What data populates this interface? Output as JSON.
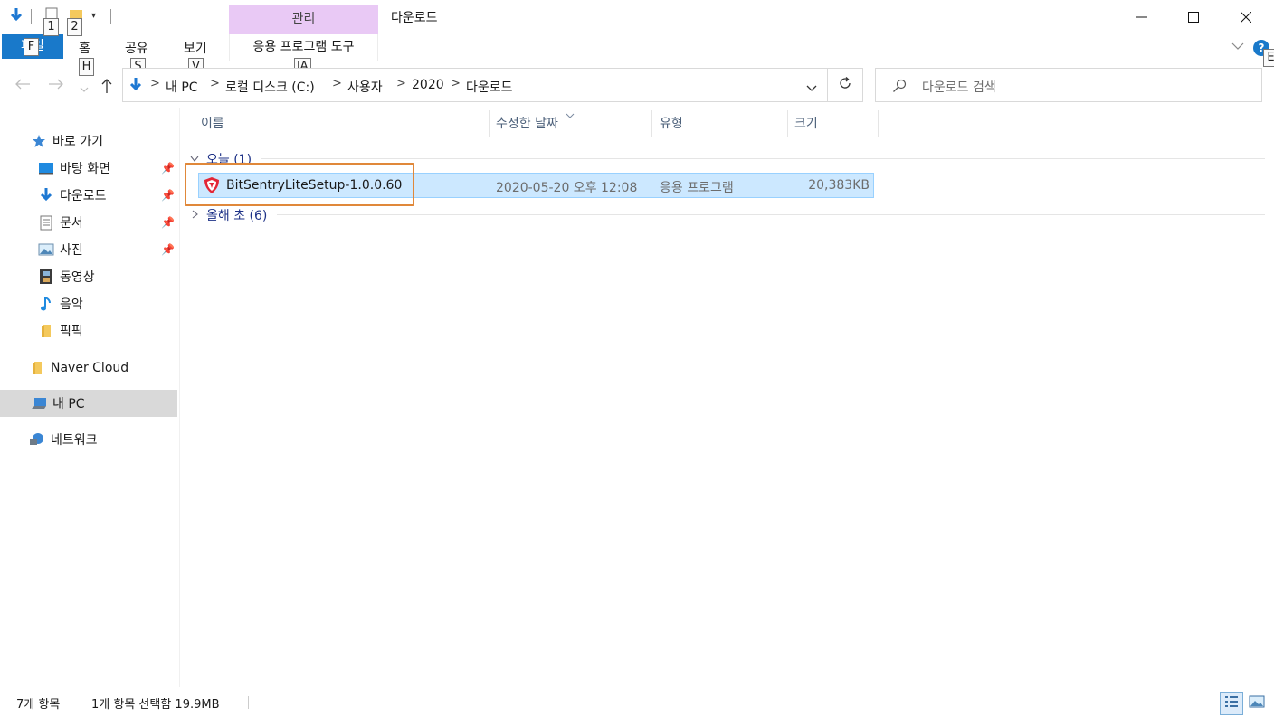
{
  "window": {
    "title": "다운로드",
    "contextual_tab": "관리",
    "contextual_group": "응용 프로그램 도구"
  },
  "ribbon": {
    "tabs": {
      "file": "파일",
      "home": "홈",
      "share": "공유",
      "view": "보기"
    },
    "keytips": {
      "qa1": "1",
      "qa2": "2",
      "file": "F",
      "home": "H",
      "share": "S",
      "view": "V",
      "apptools": "JA",
      "help": "E"
    }
  },
  "address": {
    "crumbs": [
      "내 PC",
      "로컬 디스크 (C:)",
      "사용자",
      "2020",
      "다운로드"
    ],
    "separator": ">"
  },
  "search": {
    "placeholder": "다운로드 검색"
  },
  "nav": {
    "quick_access": "바로 가기",
    "items": [
      {
        "label": "바탕 화면",
        "icon": "desktop-icon",
        "pinned": true
      },
      {
        "label": "다운로드",
        "icon": "download-arrow-icon",
        "pinned": true
      },
      {
        "label": "문서",
        "icon": "document-icon",
        "pinned": true
      },
      {
        "label": "사진",
        "icon": "picture-icon",
        "pinned": true
      },
      {
        "label": "동영상",
        "icon": "film-icon",
        "pinned": false
      },
      {
        "label": "음악",
        "icon": "music-note-icon",
        "pinned": false
      },
      {
        "label": "픽픽",
        "icon": "folder-icon",
        "pinned": false
      }
    ],
    "naver_cloud": "Naver Cloud",
    "this_pc": "내 PC",
    "network": "네트워크"
  },
  "columns": {
    "name": "이름",
    "date": "수정한 날짜",
    "type": "유형",
    "size": "크기"
  },
  "groups": {
    "today": "오늘 (1)",
    "earlier": "올해 초 (6)"
  },
  "files": [
    {
      "name": "BitSentryLiteSetup-1.0.0.60",
      "date": "2020-05-20 오후 12:08",
      "type": "응용 프로그램",
      "size": "20,383KB",
      "icon": "bitsentry-shield-icon"
    }
  ],
  "status": {
    "count": "7개 항목",
    "selection": "1개 항목 선택함 19.9MB"
  },
  "colors": {
    "file_tab": "#1979ca",
    "contextual_tab": "#e9c9f5",
    "selection": "#cce8ff",
    "highlight": "#e0883a"
  }
}
